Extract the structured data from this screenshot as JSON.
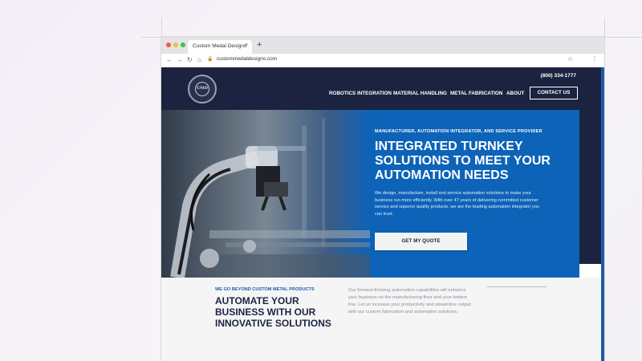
{
  "browser": {
    "tab_title": "Custom Medal Designs",
    "tab_close": "×",
    "new_tab": "+",
    "url": "custommedaldesigns.com",
    "icons": [
      "back-arrow-icon",
      "forward-arrow-icon",
      "reload-icon",
      "home-icon",
      "lock-icon",
      "star-icon",
      "menu-dots-icon"
    ],
    "traffic_light_colors": [
      "#ee5a52",
      "#f5bd2f",
      "#33c748"
    ]
  },
  "header": {
    "phone": "(800) 334-1777",
    "nav": [
      "ROBOTICS INTEGRATION",
      "MATERIAL HANDLING",
      "METAL FABRICATION",
      "ABOUT"
    ],
    "contact_label": "CONTACT US",
    "logo_monogram": "CMD"
  },
  "hero": {
    "eyebrow": "MANUFACTURER, AUTOMATION INTEGRATOR, AND SERVICE PROVIDER",
    "headline": "INTEGRATED TURNKEY SOLUTIONS TO MEET YOUR AUTOMATION NEEDS",
    "body": "We design, manufacture, install and service automation solutions to make your business run more efficiently. With over 47 years of delivering committed customer service and superior quality products, we are the leading automation integrator you can trust.",
    "cta_label": "GET MY QUOTE"
  },
  "intro": {
    "eyebrow": "WE GO BEYOND CUSTOM METAL PRODUCTS",
    "title": "AUTOMATE YOUR BUSINESS WITH OUR INNOVATIVE SOLUTIONS",
    "body": "Our forward-thinking automation capabilities will enhance your business on the manufacturing floor and your bottom line. Let us increase your productivity and streamline output with our custom fabrication and automation solutions."
  },
  "colors": {
    "navy": "#1c2340",
    "hero_blue": "#0d63b8",
    "accent_blue": "#1e5aa8",
    "light_bg": "#f5f5f6"
  }
}
